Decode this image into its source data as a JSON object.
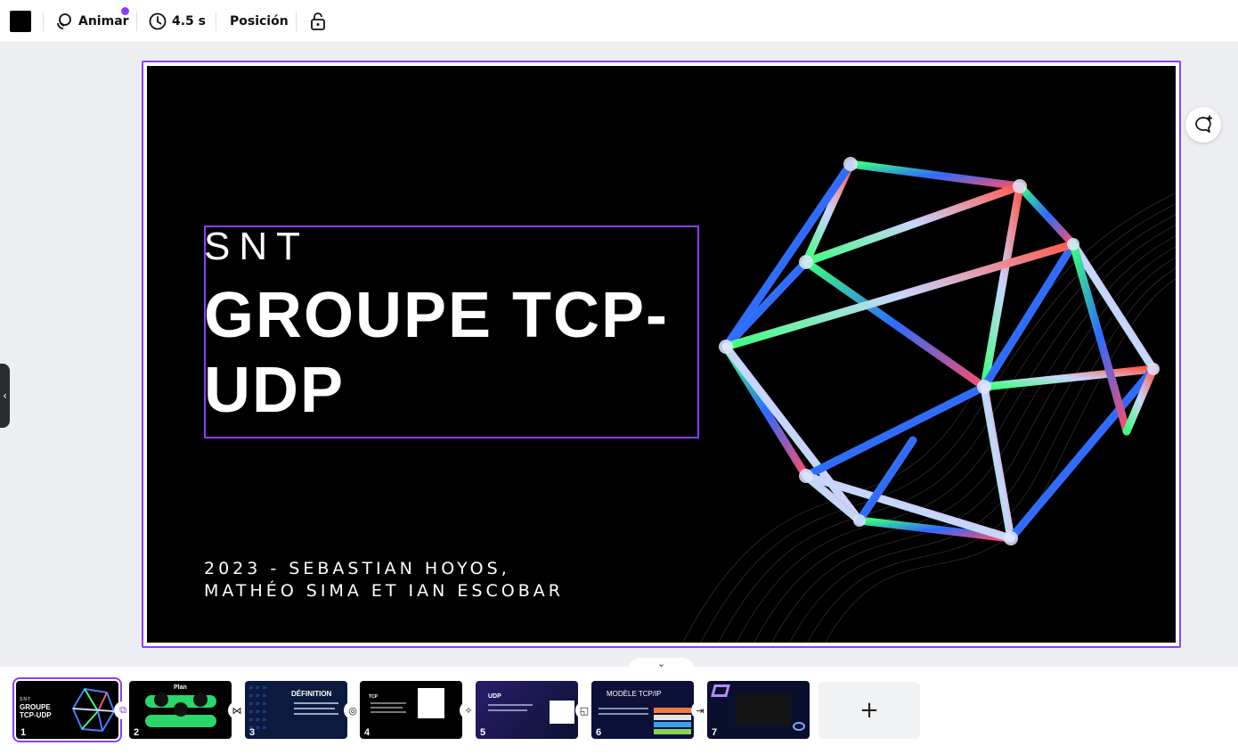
{
  "toolbar": {
    "color_swatch": "#000000",
    "animate_label": "Animar",
    "duration_label": "4.5 s",
    "position_label": "Posición",
    "lock_icon": "lock-icon"
  },
  "slide": {
    "subtitle": "SNT",
    "title": "GROUPE TCP-UDP",
    "authors_line1": "2023 - SEBASTIAN HOYOS,",
    "authors_line2": "MATHÉO SIMA ET IAN ESCOBAR"
  },
  "filmstrip": {
    "thumbs": [
      {
        "num": "1",
        "title": "GROUPE TCP-UDP",
        "pre": "SNT"
      },
      {
        "num": "2",
        "title": "Plan"
      },
      {
        "num": "3",
        "title": "DÉFINITION"
      },
      {
        "num": "4",
        "title": "TCP"
      },
      {
        "num": "5",
        "title": "UDP"
      },
      {
        "num": "6",
        "title": "MODÈLE TCP/IP"
      },
      {
        "num": "7",
        "title": ""
      }
    ],
    "add_label": "+"
  },
  "colors": {
    "accent": "#8b3dff",
    "background": "#eceef1"
  }
}
